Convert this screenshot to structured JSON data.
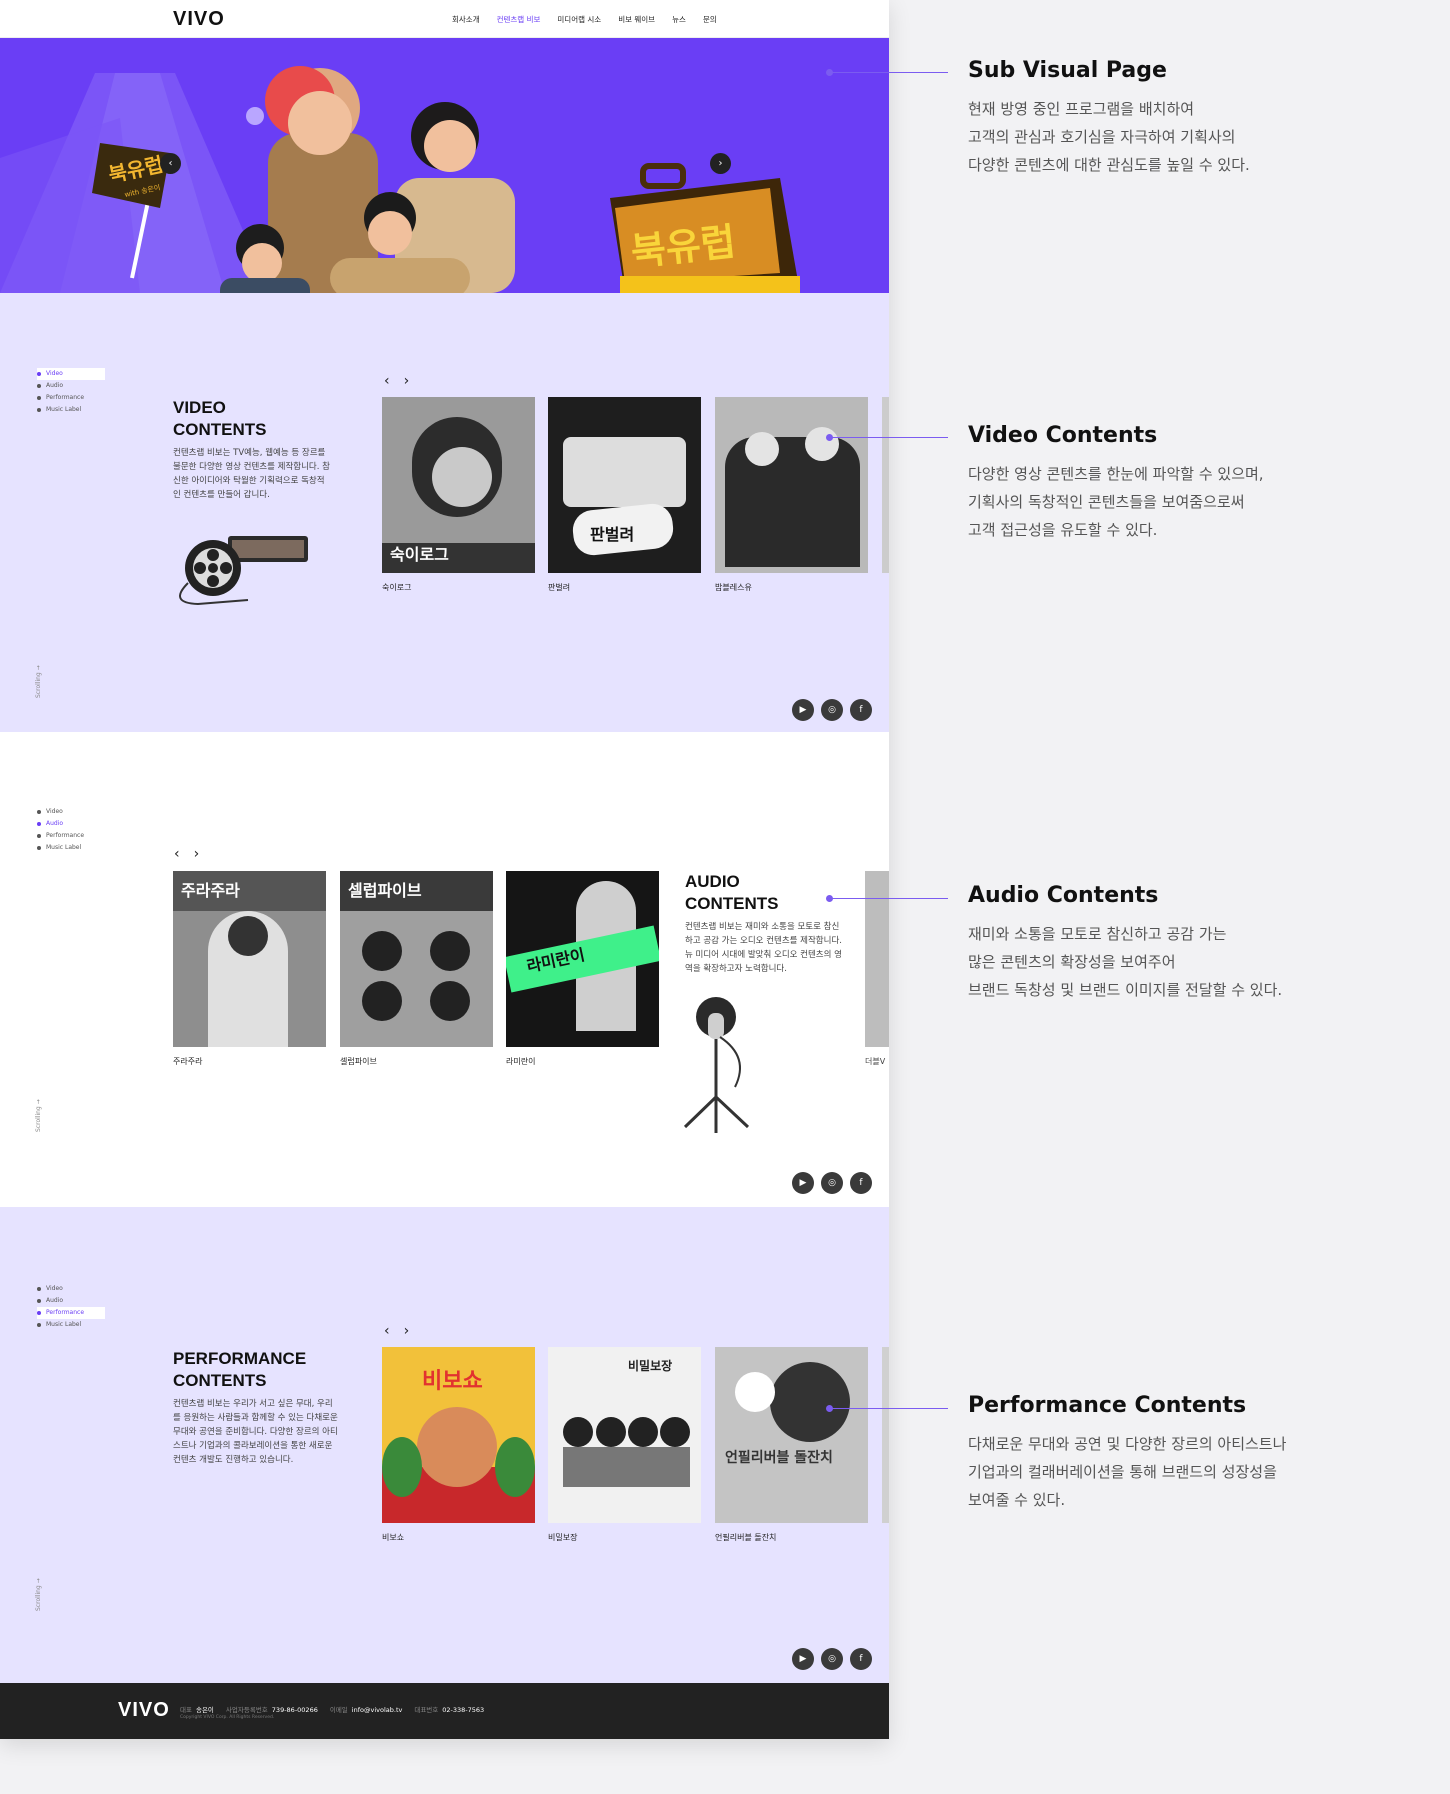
{
  "header": {
    "logo": "VIVO",
    "nav": [
      "회사소개",
      "컨텐츠랩 비보",
      "미디어랩 시소",
      "비보 웨이브",
      "뉴스",
      "문의"
    ],
    "active_nav": "컨텐츠랩 비보"
  },
  "hero": {
    "flag_text": "북유럽",
    "flag_sub": "with 송은이",
    "sign_text": "북유럽",
    "bg_color": "#6a3ef5"
  },
  "side_nav": [
    "Video",
    "Audio",
    "Performance",
    "Music Label"
  ],
  "scroll_label": "Scrolling",
  "video": {
    "title": "VIDEO\nCONTENTS",
    "desc": "컨텐츠랩 비보는 TV예능, 웹예능 등 장르를 불문한 다양한 영상 컨텐츠를 제작합니다. 참신한 아이디어와 탁월한 기획력으로 독창적인 컨텐츠를 만들어 갑니다.",
    "cards": [
      {
        "label": "숙이로그",
        "thumb_text": "숙이로그"
      },
      {
        "label": "판벌려",
        "thumb_text": "판벌려"
      },
      {
        "label": "밥블레스유",
        "thumb_text": ""
      }
    ]
  },
  "audio": {
    "title": "AUDIO\nCONTENTS",
    "desc": "컨텐츠랩 비보는 재미와 소통을 모토로 참신하고 공감 가는 오디오 컨텐츠를 제작합니다. 뉴 미디어 시대에 발맞춰 오디오 컨텐츠의 영역을 확장하고자 노력합니다.",
    "cards": [
      {
        "label": "주라주라",
        "thumb_text": "주라주라"
      },
      {
        "label": "셀럽파이브",
        "thumb_text": "셀럽파이브"
      },
      {
        "label": "라미란이",
        "thumb_text": "라미란이"
      }
    ],
    "peek_label": "더블V"
  },
  "performance": {
    "title": "PERFORMANCE\nCONTENTS",
    "desc": "컨텐츠랩 비보는 우리가 서고 싶은 무대, 우리를 응원하는 사람들과 함께할 수 있는 다채로운 무대와 공연을 준비합니다. 다양한 장르의 아티스트나 기업과의 콜라보레이션을 통한 새로운 컨텐츠 개발도 진행하고 있습니다.",
    "cards": [
      {
        "label": "비보쇼",
        "thumb_text": "비보쇼"
      },
      {
        "label": "비밀보장",
        "thumb_text": "비밀보장"
      },
      {
        "label": "언필리버블 돌잔치",
        "thumb_text": "언필리버블 돌잔치"
      }
    ]
  },
  "social_icons": [
    "youtube-icon",
    "instagram-icon",
    "facebook-icon"
  ],
  "footer": {
    "logo": "VIVO",
    "ceo_label": "대표",
    "ceo": "송은이",
    "biz_label": "사업자등록번호",
    "biz": "739-86-00266",
    "email_label": "이메일",
    "email": "info@vivolab.tv",
    "tel_label": "대표번호",
    "tel": "02-338-7563",
    "copyright": "Copyright VIVO Corp. All Rights Reserved."
  },
  "annotations": [
    {
      "title": "Sub Visual Page",
      "lines": [
        "현재 방영 중인 프로그램을 배치하여",
        "고객의 관심과 호기심을 자극하여 기획사의",
        "다양한 콘텐츠에 대한 관심도를 높일 수 있다."
      ]
    },
    {
      "title": "Video Contents",
      "lines": [
        "다양한 영상 콘텐츠를 한눈에 파악할 수 있으며,",
        "기획사의 독창적인 콘텐츠들을 보여줌으로써",
        "고객 접근성을 유도할 수 있다."
      ]
    },
    {
      "title": "Audio Contents",
      "lines": [
        "재미와 소통을 모토로 참신하고 공감 가는",
        "많은 콘텐츠의 확장성을 보여주어",
        "브랜드 독창성 및 브랜드 이미지를 전달할 수 있다."
      ]
    },
    {
      "title": "Performance Contents",
      "lines": [
        "다채로운 무대와 공연 및 다양한 장르의 아티스트나",
        "기업과의 컬래버레이션을 통해 브랜드의 성장성을",
        "보여줄 수 있다."
      ]
    }
  ],
  "colors": {
    "accent": "#6a3ef5",
    "lavender": "#e6e3ff",
    "footer": "#222222"
  }
}
